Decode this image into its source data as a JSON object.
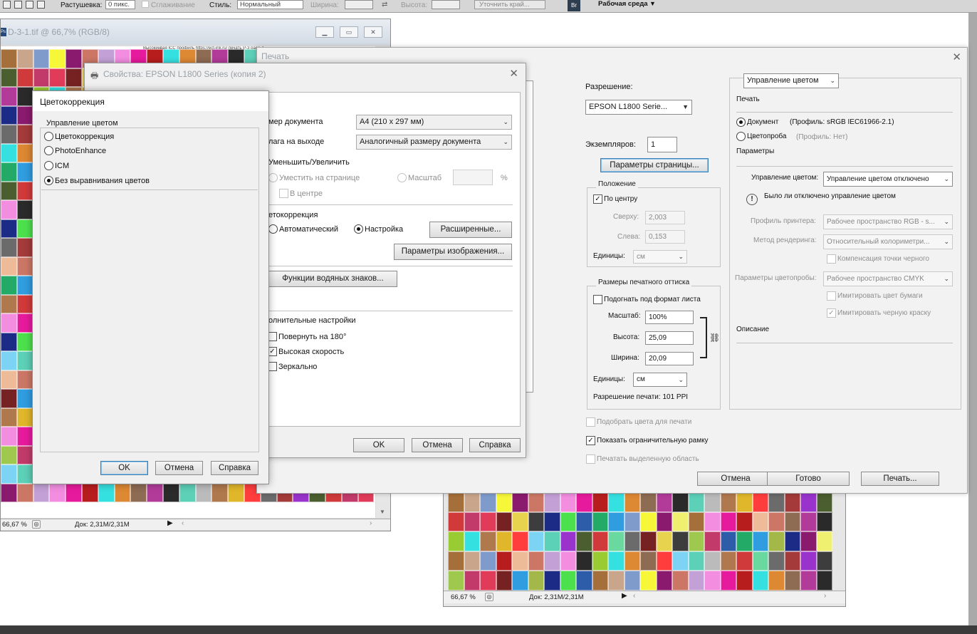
{
  "optionbar": {
    "feather_label": "Растушевка:",
    "feather_value": "0 пикс.",
    "antialias_label": "Сглаживание",
    "style_label": "Стиль:",
    "style_value": "Нормальный",
    "width_label": "Ширина:",
    "height_label": "Высота:",
    "refine_button": "Уточнить край...",
    "workspace": "Рабочая среда"
  },
  "doc_left": {
    "title": "D-3-1.tif @ 66,7% (RGB/8)",
    "header_text": "Высокинвая ICC профиль https://ect-ink.ru/ печать P-3 page-1",
    "zoom": "66,67 %",
    "doc_size": "Док: 2,31M/2,31M"
  },
  "doc_right": {
    "zoom": "66,67 %",
    "doc_size": "Док: 2,31M/2,31M"
  },
  "print_dialog": {
    "title": "Печать",
    "resolution_label": "Разрешение:",
    "printer": "EPSON L1800 Serie...",
    "copies_label": "Экземпляров:",
    "copies_value": "1",
    "page_setup_button": "Параметры страницы...",
    "position_group": "Положение",
    "center_label": "По центру",
    "top_label": "Сверху:",
    "top_value": "2,003",
    "left_label": "Слева:",
    "left_value": "0,153",
    "units_label": "Единицы:",
    "units_value": "см",
    "print_size_group": "Размеры печатного оттиска",
    "fit_label": "Подогнать под формат листа",
    "scale_label": "Масштаб:",
    "scale_value": "100%",
    "height_label": "Высота:",
    "height_value": "25,09",
    "width_label": "Ширина:",
    "width_value": "20,09",
    "units2_label": "Единицы:",
    "units2_value": "см",
    "print_resolution": "Разрешение печати: 101 PPI",
    "match_colors": "Подобрать цвета для печати",
    "show_bbox": "Показать ограничительную рамку",
    "print_selected": "Печатать выделенную область",
    "cancel": "Отмена",
    "done": "Готово",
    "print": "Печать...",
    "cm_section": "Управление цветом",
    "print_heading": "Печать",
    "document_label": "Документ",
    "document_profile": "(Профиль: sRGB IEC61966-2.1)",
    "proof_label": "Цветопроба",
    "proof_profile": "(Профиль: Нет)",
    "params_heading": "Параметры",
    "color_handling_label": "Управление цветом:",
    "color_handling_value": "Управление цветом отключено",
    "warning_text": "Было ли отключено управление цветом",
    "printer_profile_label": "Профиль принтера:",
    "printer_profile_value": "Рабочее пространство RGB - s...",
    "render_label": "Метод рендеринга:",
    "render_value": "Относительный колориметри...",
    "bpc_label": "Компенсация точки черного",
    "proof_setup_label": "Параметры цветопробы:",
    "proof_setup_value": "Рабочее пространство CMYK",
    "paper_color": "Имитировать цвет бумаги",
    "black_ink": "Имитировать черную краску",
    "description_heading": "Описание"
  },
  "epson_dialog": {
    "title": "Свойства: EPSON L1800 Series (копия 2)",
    "tab_fragment": "s",
    "doc_size_label": "мер документа",
    "doc_size_value": "A4 (210 x 297 мм)",
    "output_label": "лага на выходе",
    "output_value": "Аналогичный размеру документа",
    "reduce_label": "Уменьшить/Увеличить",
    "fit_page": "Уместить на странице",
    "scale_label": "Масштаб",
    "percent": "%",
    "center_label": "В центре",
    "cc_heading": "етокоррекция",
    "auto_label": "Автоматический",
    "custom_label": "Настройка",
    "advanced_button": "Расширенные...",
    "image_options_button": "Параметры изображения...",
    "watermark_button": "Функции водяных знаков...",
    "extra_heading": "олнительные настройки",
    "rotate_label": "Повернуть на 180°",
    "highspeed_label": "Высокая скорость",
    "mirror_label": "Зеркально",
    "ok": "OK",
    "cancel": "Отмена",
    "help": "Справка"
  },
  "cc_dialog": {
    "title": "Цветокоррекция",
    "group": "Управление цветом",
    "opt1": "Цветокоррекция",
    "opt2": "PhotoEnhance",
    "opt3": "ICM",
    "opt4": "Без выравнивания цветов",
    "ok": "OK",
    "cancel": "Отмена",
    "help": "Справка"
  },
  "icons": {
    "printer": "printer-icon",
    "warning": "warning-icon",
    "chain": "chain-link-icon",
    "close": "close-icon"
  }
}
